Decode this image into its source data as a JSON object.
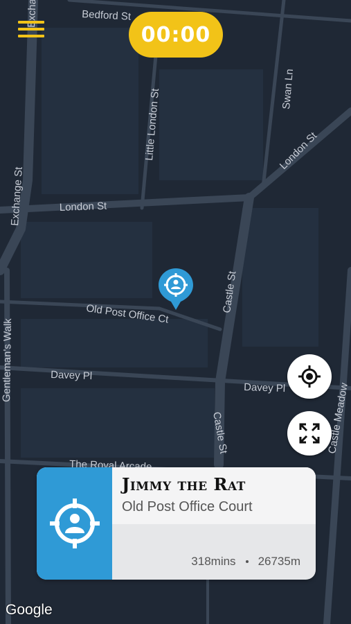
{
  "map": {
    "streets": {
      "bedford_st": "Bedford St",
      "exchange_top": "Exchar",
      "little_london_st": "Little London St",
      "swan_ln": "Swan Ln",
      "london_st_right": "London St",
      "exchange_st": "Exchange St",
      "london_st": "London St",
      "castle_st_upper": "Castle St",
      "old_post_office_ct": "Old Post Office Ct",
      "castle_meadow": "Castle Meadow",
      "davey_pl_left": "Davey Pl",
      "davey_pl_right": "Davey Pl",
      "gentlemans_walk": "Gentleman's Walk",
      "castle_st_lower": "Castle St",
      "royal_arcade": "The Royal Arcade"
    },
    "attribution": "Google"
  },
  "header": {
    "timer": "00:00"
  },
  "target_card": {
    "name": "Jimmy the Rat",
    "location": "Old Post Office Court",
    "time": "318mins",
    "distance": "26735m"
  },
  "colors": {
    "accent_yellow": "#f2c318",
    "target_blue": "#2f9ad6",
    "map_bg": "#1f2835"
  },
  "icons": {
    "menu": "hamburger-menu-icon",
    "locate": "crosshair-icon",
    "expand": "expand-arrows-icon",
    "target": "target-person-icon"
  }
}
